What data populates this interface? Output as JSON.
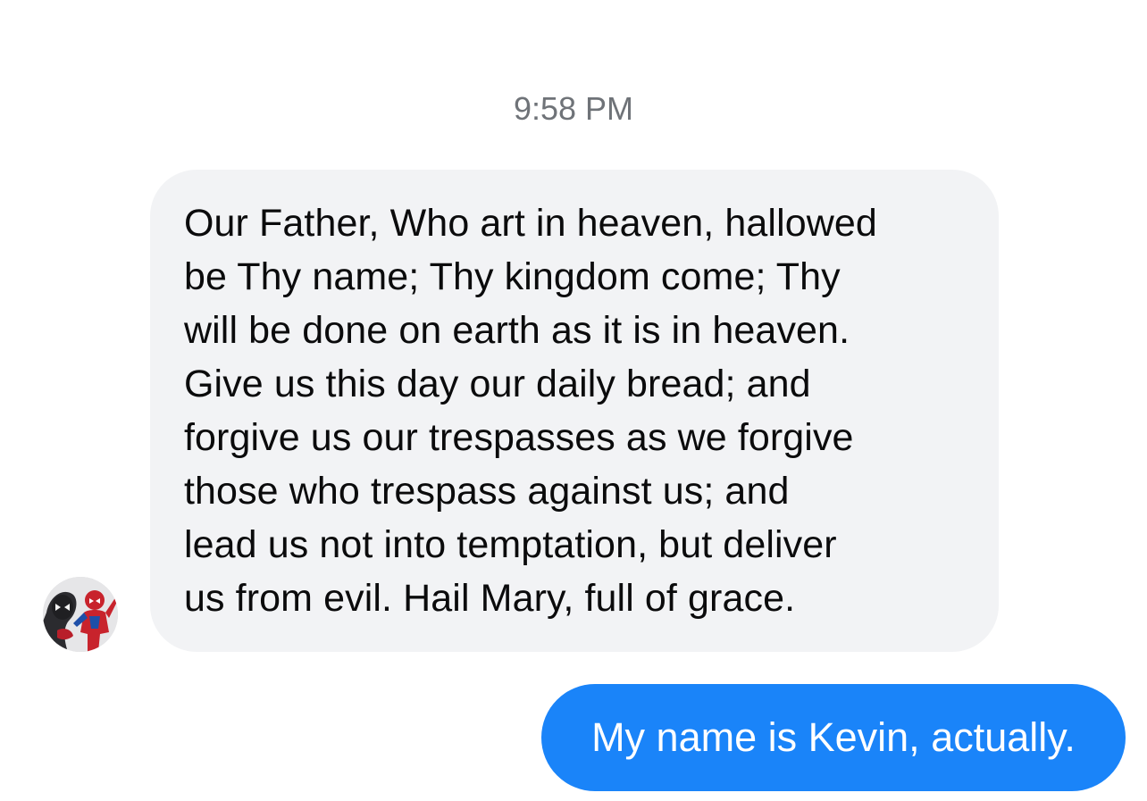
{
  "conversation": {
    "timestamp": "9:58 PM",
    "incoming_message": {
      "lines": [
        "Our Father, Who art in heaven, hallowed",
        "be Thy name; Thy kingdom come; Thy",
        "will be done on earth as it is in heaven.",
        "Give us this day our daily bread; and",
        "forgive us our trespasses as we forgive",
        "those who trespass against us; and",
        "lead us not into temptation, but deliver",
        "us from evil. Hail Mary, full of grace."
      ],
      "avatar_icon": "spider-man-avatar-icon",
      "bubble_color": "#f2f3f5"
    },
    "outgoing_message": {
      "text": "My name is Kevin, actually.",
      "bubble_color": "#1a84f9"
    }
  }
}
